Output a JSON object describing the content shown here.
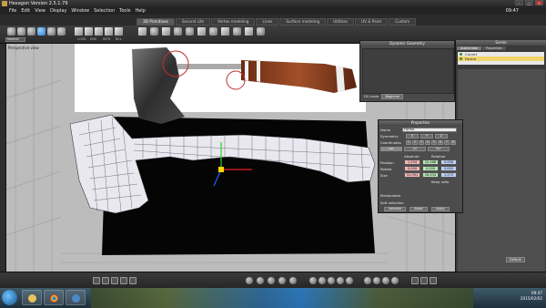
{
  "app": {
    "title": "Hexagon Version 2.5.1.79",
    "clock": "09:47"
  },
  "menu": [
    "File",
    "Edit",
    "View",
    "Display",
    "Window",
    "Selection",
    "Tools",
    "Help"
  ],
  "tabs": [
    {
      "label": "3D Primitives",
      "active": true
    },
    {
      "label": "Second Life",
      "active": false
    },
    {
      "label": "Vertex modeling",
      "active": false
    },
    {
      "label": "Lines",
      "active": false
    },
    {
      "label": "Surface modeling",
      "active": false
    },
    {
      "label": "Utilities",
      "active": false
    },
    {
      "label": "UV & Paint",
      "active": false
    },
    {
      "label": "Custom",
      "active": false
    }
  ],
  "toolbar": {
    "mode": "Normal",
    "labels": [
      "LOOK",
      "ENV",
      "INTR",
      "BCL"
    ]
  },
  "viewport": {
    "label": "Perspective view"
  },
  "dynamic_geometry": {
    "title": "Dynamic Geometry",
    "dg_mode_label": "DG mode",
    "dg_mode_value": "Beginner"
  },
  "scene": {
    "title": "Scene",
    "tabs": [
      "Scene tree",
      "Properties"
    ],
    "items": [
      {
        "label": "Curve1",
        "selected": false
      },
      {
        "label": "Forma",
        "selected": true
      }
    ],
    "bottom_button": "Default"
  },
  "properties": {
    "title": "Properties",
    "name_label": "Name",
    "name_value": "Forma",
    "symmetry_label": "Symmetry",
    "axes": [
      "X",
      "Y",
      "Z"
    ],
    "coordinates_label": "Coordinates",
    "coord_nums": [
      "1",
      "2",
      "3",
      "4",
      "5",
      "6",
      "7",
      "8"
    ],
    "modes": [
      "Loc",
      "Lcl",
      "Scr"
    ],
    "absolute_label": "Absolute",
    "relative_label": "Relative",
    "position_label": "Position",
    "rotate_label": "Rotate",
    "size_label": "Size",
    "position": [
      "1.534",
      "20.468",
      "0.000"
    ],
    "rotate": [
      "0.000",
      "0.000",
      "0.000"
    ],
    "size": [
      "31.951",
      "26.434",
      "1.272"
    ],
    "keep_ratio_label": "Keep ratio",
    "manipulator_label": "Manipulator",
    "soft_selection_label": "Soft selection",
    "buttons": [
      "Validate",
      "Abort",
      "Apply"
    ]
  },
  "taskbar": {
    "time": "09:47",
    "date": "2015/02/02"
  },
  "colors": {
    "accent_selected": "#f0d36a",
    "mesh_fill": "#e6e6ea",
    "handle_wood": "#8a3a1e"
  }
}
